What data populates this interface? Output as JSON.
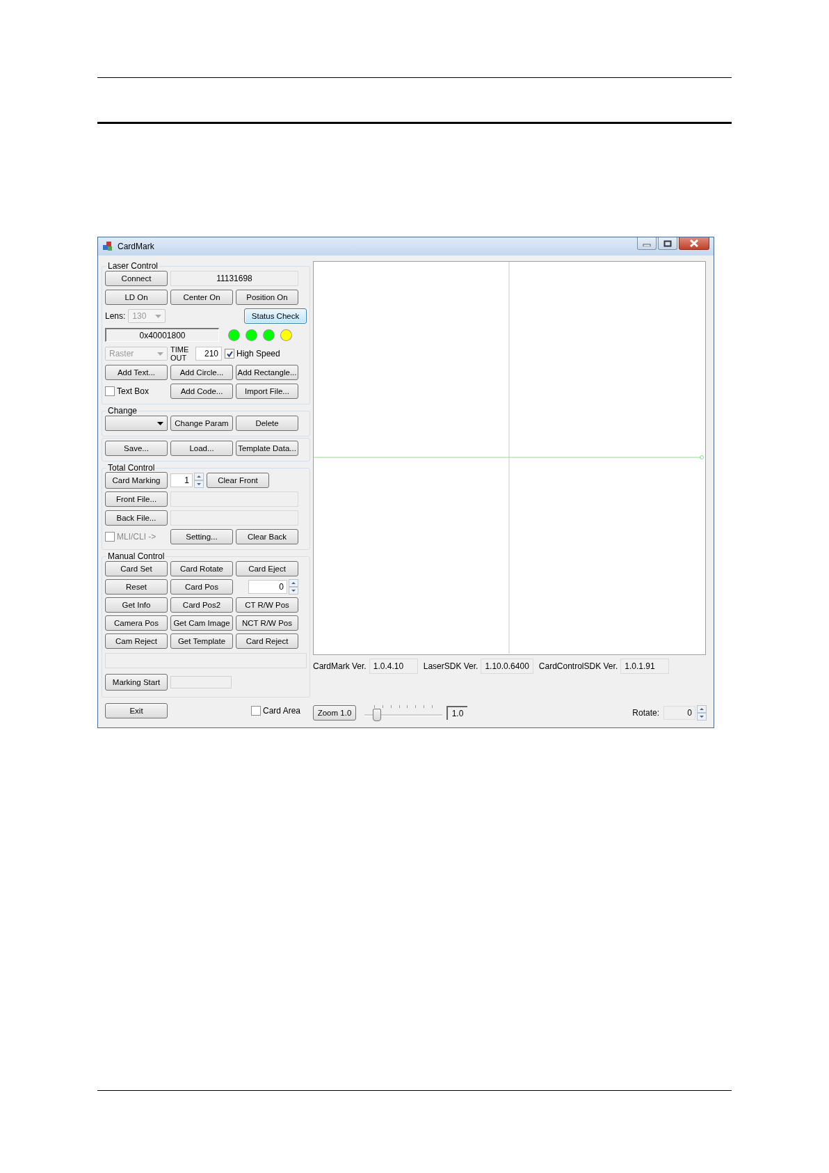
{
  "window": {
    "title": "CardMark"
  },
  "laser_control": {
    "title": "Laser Control",
    "connect": "Connect",
    "serial": "11131698",
    "toggles": [
      "LD On",
      "Center On",
      "Position On"
    ],
    "lens": {
      "label": "Lens:",
      "value": "130",
      "disabled": true
    },
    "status_check": {
      "label": "Status Check",
      "focused": true
    },
    "status_code": "0x40001800",
    "indicators": [
      {
        "color": "#00ff00"
      },
      {
        "color": "#00ff00"
      },
      {
        "color": "#00ff00"
      },
      {
        "color": "#ffff00"
      }
    ],
    "mode": {
      "value": "Raster",
      "disabled": true
    },
    "timeout": {
      "label": "TIME OUT",
      "value": "210"
    },
    "high_speed": {
      "label": "High Speed",
      "checked": true
    },
    "add_buttons": [
      "Add Text...",
      "Add Circle...",
      "Add Rectangle..."
    ],
    "text_box": {
      "label": "Text Box",
      "checked": false
    },
    "more_buttons": [
      "Add Code...",
      "Import File..."
    ]
  },
  "change": {
    "title": "Change",
    "buttons": [
      "Change Param",
      "Delete"
    ]
  },
  "file_buttons": [
    "Save...",
    "Load...",
    "Template Data..."
  ],
  "total_control": {
    "title": "Total Control",
    "card_marking": "Card Marking",
    "count": "1",
    "clear_front": "Clear Front",
    "front_file": "Front File...",
    "back_file": "Back File...",
    "mli_cli": {
      "label": "MLI/CLI ->",
      "checked": false,
      "disabled": true
    },
    "setting": "Setting...",
    "clear_back": "Clear Back"
  },
  "manual_control": {
    "title": "Manual Control",
    "items": [
      {
        "kind": "button",
        "label": "Card Set"
      },
      {
        "kind": "button",
        "label": "Card Rotate"
      },
      {
        "kind": "button",
        "label": "Card Eject"
      },
      {
        "kind": "button",
        "label": "Reset"
      },
      {
        "kind": "button",
        "label": "Card Pos"
      },
      {
        "kind": "spinner",
        "value": "0"
      },
      {
        "kind": "button",
        "label": "Get Info"
      },
      {
        "kind": "button",
        "label": "Card Pos2"
      },
      {
        "kind": "button",
        "label": "CT R/W Pos"
      },
      {
        "kind": "button",
        "label": "Camera Pos"
      },
      {
        "kind": "button",
        "label": "Get Cam Image"
      },
      {
        "kind": "button",
        "label": "NCT R/W Pos"
      },
      {
        "kind": "button",
        "label": "Cam Reject"
      },
      {
        "kind": "button",
        "label": "Get Template"
      },
      {
        "kind": "button",
        "label": "Card Reject"
      }
    ],
    "marking_start": "Marking Start"
  },
  "exit": "Exit",
  "card_area": {
    "label": "Card Area",
    "checked": false
  },
  "versions": [
    {
      "label": "CardMark Ver.",
      "value": "1.0.4.10"
    },
    {
      "label": "LaserSDK Ver.",
      "value": "1.10.0.6400"
    },
    {
      "label": "CardControlSDK Ver.",
      "value": "1.0.1.91"
    }
  ],
  "zoom": {
    "button": "Zoom 1.0",
    "level": 0.15,
    "value": "1.0"
  },
  "rotate": {
    "label": "Rotate:",
    "value": "0"
  }
}
